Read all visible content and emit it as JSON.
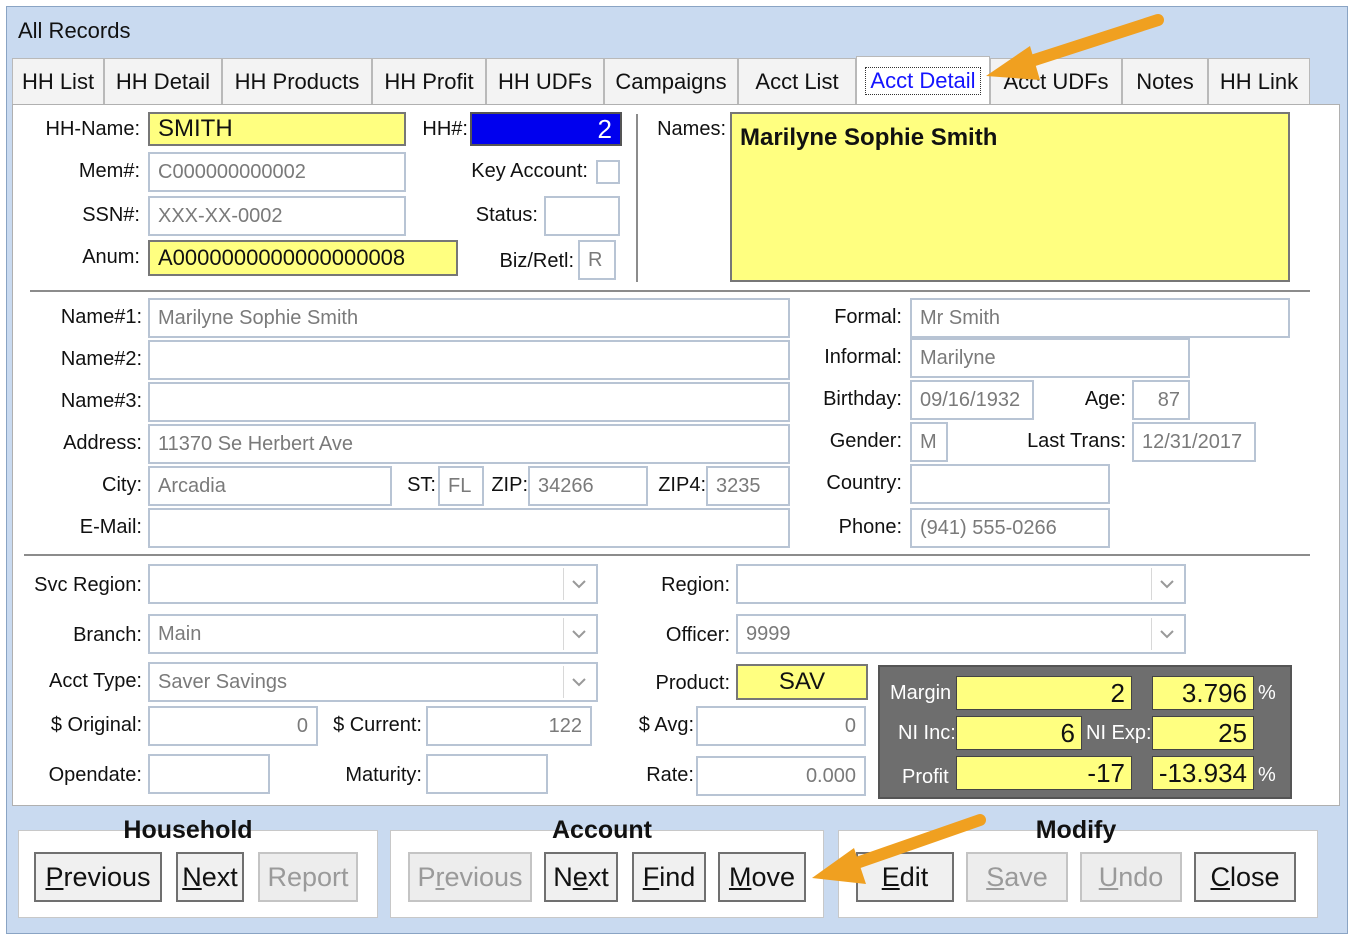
{
  "window": {
    "title": "All Records"
  },
  "tabs": [
    "HH List",
    "HH Detail",
    "HH Products",
    "HH Profit",
    "HH UDFs",
    "Campaigns",
    "Acct List",
    "Acct Detail",
    "Acct UDFs",
    "Notes",
    "HH Link"
  ],
  "household": {
    "hh_name_label": "HH-Name:",
    "hh_name": "SMITH",
    "hh_num_label": "HH#:",
    "hh_num": "2",
    "mem_label": "Mem#:",
    "mem": "C000000000002",
    "key_account_label": "Key Account:",
    "ssn_label": "SSN#:",
    "ssn": "XXX-XX-0002",
    "status_label": "Status:",
    "status": "",
    "anum_label": "Anum:",
    "anum": "A0000000000000000008",
    "biz_label": "Biz/Retl:",
    "biz": "R",
    "names_label": "Names:",
    "names": "Marilyne Sophie Smith"
  },
  "contact": {
    "name1_label": "Name#1:",
    "name1": "Marilyne Sophie Smith",
    "name2_label": "Name#2:",
    "name2": "",
    "name3_label": "Name#3:",
    "name3": "",
    "address_label": "Address:",
    "address": "11370 Se Herbert Ave",
    "city_label": "City:",
    "city": "Arcadia",
    "st_label": "ST:",
    "st": "FL",
    "zip_label": "ZIP:",
    "zip": "34266",
    "zip4_label": "ZIP4:",
    "zip4": "3235",
    "email_label": "E-Mail:",
    "email": "",
    "formal_label": "Formal:",
    "formal": "Mr Smith",
    "informal_label": "Informal:",
    "informal": "Marilyne",
    "birthday_label": "Birthday:",
    "birthday": "09/16/1932",
    "age_label": "Age:",
    "age": "87",
    "gender_label": "Gender:",
    "gender": "M",
    "last_trans_label": "Last Trans:",
    "last_trans": "12/31/2017",
    "country_label": "Country:",
    "country": "",
    "phone_label": "Phone:",
    "phone": "(941) 555-0266"
  },
  "account": {
    "svc_region_label": "Svc Region:",
    "svc_region": "",
    "region_label": "Region:",
    "region": "",
    "branch_label": "Branch:",
    "branch": "Main",
    "officer_label": "Officer:",
    "officer": "9999",
    "acct_type_label": "Acct Type:",
    "acct_type": "Saver Savings",
    "product_label": "Product:",
    "product": "SAV",
    "original_label": "$ Original:",
    "original": "0",
    "current_label": "$ Current:",
    "current": "122",
    "avg_label": "$ Avg:",
    "avg": "0",
    "opendate_label": "Opendate:",
    "opendate": "",
    "maturity_label": "Maturity:",
    "maturity": "",
    "rate_label": "Rate:",
    "rate": "0.000"
  },
  "profit": {
    "margin_label": "Margin",
    "margin": "2",
    "margin_pct": "3.796",
    "ni_inc_label": "NI Inc:",
    "ni_inc": "6",
    "ni_exp_label": "NI Exp:",
    "ni_exp": "25",
    "profit_label": "Profit",
    "profit": "-17",
    "profit_pct": "-13.934",
    "pct_symbol": "%"
  },
  "groups": {
    "household": {
      "title": "Household",
      "previous": "Previous",
      "next": "Next",
      "report": "Report"
    },
    "account": {
      "title": "Account",
      "previous": "Previous",
      "next": "Next",
      "find": "Find",
      "move": "Move"
    },
    "modify": {
      "title": "Modify",
      "edit": "Edit",
      "save": "Save",
      "undo": "Undo",
      "close": "Close"
    }
  },
  "colors": {
    "highlight_yellow": "#ffff80",
    "hh_num_bg": "#0000ee",
    "active_tab_text": "#1414ff",
    "arrow": "#f0a020"
  }
}
